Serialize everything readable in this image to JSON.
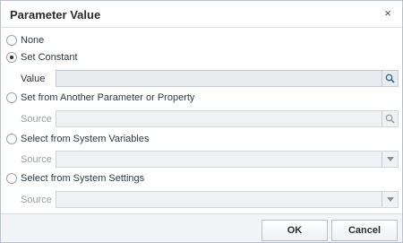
{
  "dialog": {
    "title": "Parameter Value",
    "close_label": "×"
  },
  "options": [
    {
      "label": "None",
      "checked": false
    },
    {
      "label": "Set Constant",
      "checked": true
    },
    {
      "label": "Set from Another Parameter or Property",
      "checked": false
    },
    {
      "label": "Select from System Variables",
      "checked": false
    },
    {
      "label": "Select from System Settings",
      "checked": false
    }
  ],
  "fields": {
    "value": {
      "label": "Value",
      "value": "",
      "icon": "search-icon",
      "enabled": true
    },
    "source_parameter": {
      "label": "Source",
      "value": "",
      "icon": "search-icon",
      "enabled": false
    },
    "source_system_variables": {
      "label": "Source",
      "value": "",
      "icon": "chevron-down-icon",
      "enabled": false
    },
    "source_system_settings": {
      "label": "Source",
      "value": "",
      "icon": "chevron-down-icon",
      "enabled": false
    }
  },
  "buttons": {
    "ok": "OK",
    "cancel": "Cancel"
  },
  "colors": {
    "border": "#b9c1cc",
    "field_bg": "#e9ebee",
    "disabled_text": "#9aa0a6",
    "footer_bg": "#f3f4f6"
  }
}
